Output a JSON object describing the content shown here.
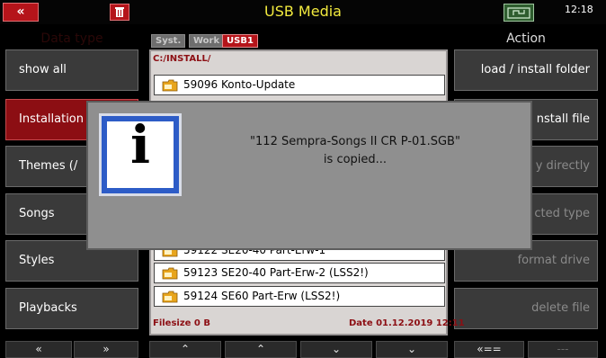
{
  "topbar": {
    "back_label": "«",
    "title": "USB Media",
    "time": "12:18"
  },
  "left": {
    "header": "Data type",
    "items": [
      {
        "label": "show all"
      },
      {
        "label": "Installation"
      },
      {
        "label": "Themes (/"
      },
      {
        "label": "Songs"
      },
      {
        "label": "Styles"
      },
      {
        "label": "Playbacks"
      }
    ]
  },
  "tabs": [
    "Syst.",
    "Work",
    "USB1"
  ],
  "files": {
    "path": "C:/INSTALL/",
    "items": [
      {
        "name": "59096 Konto-Update"
      },
      {
        "name": "59122 SE20-40 Part-Erw-1"
      },
      {
        "name": "59123 SE20-40 Part-Erw-2 (LSS2!)"
      },
      {
        "name": "59124 SE60 Part-Erw (LSS2!)"
      }
    ],
    "filesize": "Filesize 0 B",
    "date": "Date 01.12.2019  12:11"
  },
  "right": {
    "header": "Action",
    "items": [
      {
        "label": "load  /  install folder"
      },
      {
        "label": "nstall file"
      },
      {
        "label": "y directly"
      },
      {
        "label": "cted type"
      },
      {
        "label": "format drive"
      },
      {
        "label": "delete file"
      }
    ]
  },
  "dialog": {
    "icon": "info-icon",
    "line1": "\"112 Sempra-Songs II CR P-01.SGB\"",
    "line2": "is copied..."
  },
  "bottom": {
    "buttons": [
      "«",
      "»",
      "⌃",
      "⌃",
      "⌄",
      "⌄",
      "«==",
      "---"
    ]
  },
  "colors": {
    "accent": "#b5141a",
    "title": "#f2ea3e"
  }
}
